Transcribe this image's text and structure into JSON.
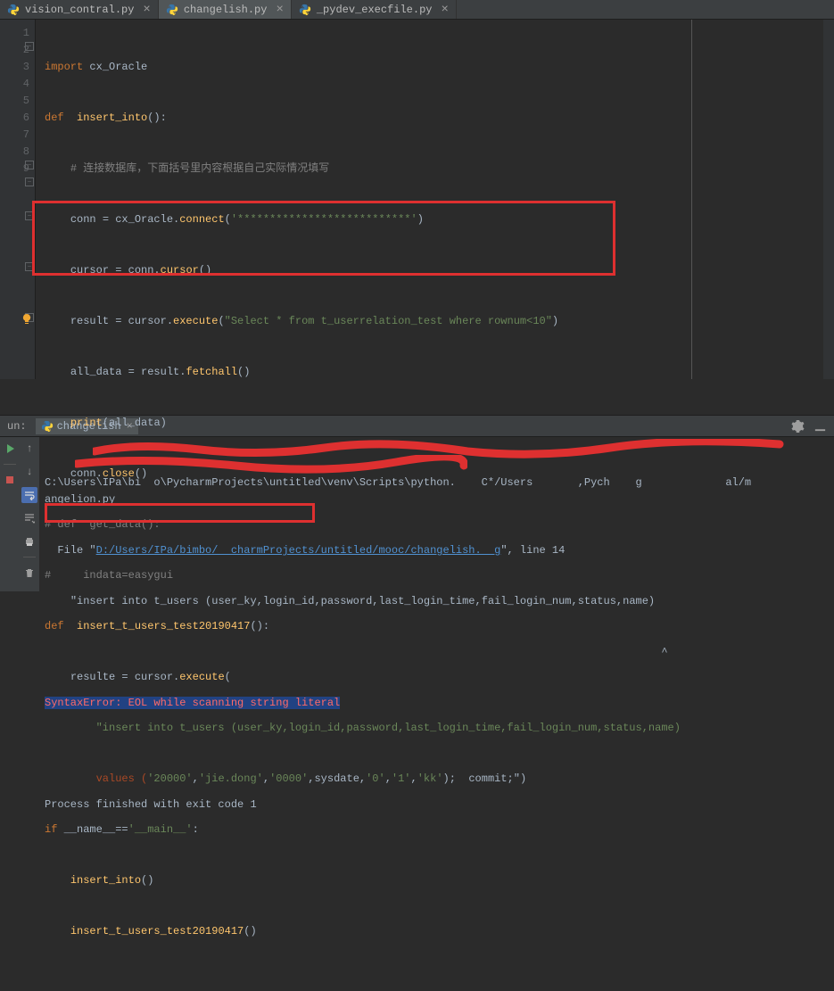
{
  "tabs": [
    {
      "label": "vision_contral.py",
      "active": false
    },
    {
      "label": "changelish.py",
      "active": true
    },
    {
      "label": "_pydev_execfile.py",
      "active": false
    }
  ],
  "gutter": [
    "1",
    "2",
    "3",
    "4",
    "5",
    "6",
    "7",
    "8",
    "9",
    "",
    "",
    "",
    "",
    "",
    "",
    "",
    "",
    "",
    ""
  ],
  "code": {
    "l1": {
      "kw": "import",
      "mod": "cx_Oracle"
    },
    "l2": {
      "kw": "def",
      "name": "insert_into",
      "paren": "():"
    },
    "l3": {
      "cmt": "# 连接数据库，下面括号里内容根据自己实际情况填写"
    },
    "l4": {
      "a": "conn = cx_Oracle.",
      "fn": "connect",
      "b": "(",
      "str": "'***************************'",
      "c": ")"
    },
    "l5": {
      "a": "cursor = conn.",
      "fn": "cursor",
      "b": "()"
    },
    "l6": {
      "a": "result = cursor.",
      "fn": "execute",
      "b": "(",
      "str": "\"Select * from t_userrelation_test where rownum<10\"",
      "c": ")"
    },
    "l7": {
      "a": "all_data = result.",
      "fn": "fetchall",
      "b": "()"
    },
    "l8": {
      "fn": "print",
      "a": "(all_data)"
    },
    "l9": {
      "a": "conn.",
      "fn": "close",
      "b": "()"
    },
    "l10": {
      "cmt": "# def  get_data():"
    },
    "l11": {
      "cmt": "#     indata=easygui"
    },
    "l12": {
      "kw": "def",
      "name": "insert_t_users_test20190417",
      "paren": "():"
    },
    "l13": {
      "a": "resulte = cursor.",
      "fn": "execute",
      "b": "("
    },
    "l14": {
      "str": "\"insert into t_users (user_ky,login_id,password,last_login_time,fail_login_num,status,name)"
    },
    "l15": {
      "a": "values (",
      "s1": "'20000'",
      "c1": ",",
      "s2": "'jie.dong'",
      "c2": ",",
      "s3": "'0000'",
      "c3": ",sysdate,",
      "s4": "'0'",
      "c4": ",",
      "s5": "'1'",
      "c5": ",",
      "s6": "'kk'",
      "c6": ");  commit;",
      "end": "\")"
    },
    "l16": {
      "kw": "if",
      "a": " __name__",
      "op": "==",
      "str": "'__main__'",
      "b": ":"
    },
    "l17": {
      "fn": "insert_into",
      "a": "()"
    },
    "l18": {
      "fn": "insert_t_users_test20190417",
      "a": "()"
    }
  },
  "run": {
    "panel": "un:",
    "tab": "changelish"
  },
  "console": {
    "l1": "C:\\Users\\IPa\\bi  o\\PycharmProjects\\untitled\\venv\\Scripts\\python.    C*/Users       ,Pych    g             al/m         angelion.py",
    "l2a": "  File \"",
    "l2b": "D:/Users/IPa/bimbo/  charmProjects/untitled/mooc/changelish.  g",
    "l2c": "\", line 14",
    "l3": "    \"insert into t_users (user_ky,login_id,password,last_login_time,fail_login_num,status,name)",
    "l4": "                                                                                                ^",
    "l5": "SyntaxError: EOL while scanning string literal",
    "l6": "",
    "l7": "Process finished with exit code 1"
  }
}
